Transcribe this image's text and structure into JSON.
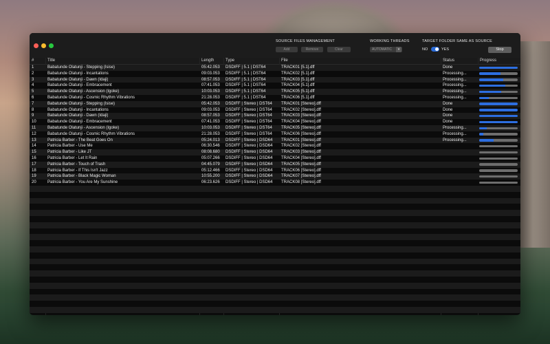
{
  "toolbar": {
    "source_group_label": "SOURCE FILES MANAGEMENT",
    "add_label": "Add",
    "remove_label": "Remove",
    "clear_label": "Clear",
    "threads_label": "WORKING THREADS",
    "threads_value": "AUTOMATIC",
    "target_label": "TARGET FOLDER SAME AS SOURCE",
    "toggle_no": "NO",
    "toggle_yes": "YES",
    "stop_label": "Stop"
  },
  "columns": {
    "num": "#",
    "title": "Title",
    "length": "Length",
    "type": "Type",
    "file": "File",
    "status": "Status",
    "progress": "Progress"
  },
  "rows": [
    {
      "num": "1",
      "title": "Babatunde Olatunji - Stepping (Isise)",
      "length": "05:42.053",
      "type": "DSDIFF | 5.1 | DST64",
      "file": "TRACK01 [5.1].dff",
      "status": "Done",
      "progress": 1.0
    },
    {
      "num": "2",
      "title": "Babatunde Olatunji - Incantations",
      "length": "09:03.053",
      "type": "DSDIFF | 5.1 | DST64",
      "file": "TRACK02 [5.1].dff",
      "status": "Processing...",
      "progress": 0.55
    },
    {
      "num": "3",
      "title": "Babatunde Olatunji - Dawn (Idaji)",
      "length": "08:57.053",
      "type": "DSDIFF | 5.1 | DST64",
      "file": "TRACK03 [5.1].dff",
      "status": "Processing...",
      "progress": 0.62
    },
    {
      "num": "4",
      "title": "Babatunde Olatunji - Embracement",
      "length": "07:41.053",
      "type": "DSDIFF | 5.1 | DST64",
      "file": "TRACK04 [5.1].dff",
      "status": "Processing...",
      "progress": 0.68
    },
    {
      "num": "5",
      "title": "Babatunde Olatunji - Ascension (Igoke)",
      "length": "10:03.053",
      "type": "DSDIFF | 5.1 | DST64",
      "file": "TRACK05 [5.1].dff",
      "status": "Processing...",
      "progress": 0.58
    },
    {
      "num": "6",
      "title": "Babatunde Olatunji - Cosmic Rhythm Vibrations",
      "length": "21:28.053",
      "type": "DSDIFF | 5.1 | DST64",
      "file": "TRACK06 [5.1].dff",
      "status": "Processing...",
      "progress": 0.25
    },
    {
      "num": "7",
      "title": "Babatunde Olatunji - Stepping (Isise)",
      "length": "05:42.053",
      "type": "DSDIFF | Stereo | DST64",
      "file": "TRACK01 [Stereo].dff",
      "status": "Done",
      "progress": 1.0
    },
    {
      "num": "8",
      "title": "Babatunde Olatunji - Incantations",
      "length": "09:03.053",
      "type": "DSDIFF | Stereo | DST64",
      "file": "TRACK02 [Stereo].dff",
      "status": "Done",
      "progress": 1.0
    },
    {
      "num": "9",
      "title": "Babatunde Olatunji - Dawn (Idaji)",
      "length": "08:57.053",
      "type": "DSDIFF | Stereo | DST64",
      "file": "TRACK03 [Stereo].dff",
      "status": "Done",
      "progress": 1.0
    },
    {
      "num": "10",
      "title": "Babatunde Olatunji - Embracement",
      "length": "07:41.053",
      "type": "DSDIFF | Stereo | DST64",
      "file": "TRACK04 [Stereo].dff",
      "status": "Done",
      "progress": 1.0
    },
    {
      "num": "11",
      "title": "Babatunde Olatunji - Ascension (Igoke)",
      "length": "10:03.053",
      "type": "DSDIFF | Stereo | DST64",
      "file": "TRACK05 [Stereo].dff",
      "status": "Processing...",
      "progress": 0.2
    },
    {
      "num": "12",
      "title": "Babatunde Olatunji - Cosmic Rhythm Vibrations",
      "length": "21:28.053",
      "type": "DSDIFF | Stereo | DST64",
      "file": "TRACK06 [Stereo].dff",
      "status": "Processing...",
      "progress": 0.1
    },
    {
      "num": "13",
      "title": "Patricia Barber - The Beat Goes On",
      "length": "05:24.013",
      "type": "DSDIFF | Stereo | DSD64",
      "file": "TRACK01 [Stereo].dff",
      "status": "Processing...",
      "progress": 0.38
    },
    {
      "num": "14",
      "title": "Patricia Barber - Use Me",
      "length": "06:30.546",
      "type": "DSDIFF | Stereo | DSD64",
      "file": "TRACK02 [Stereo].dff",
      "status": "",
      "progress": 0
    },
    {
      "num": "15",
      "title": "Patricia Barber - Like JT",
      "length": "08:08.680",
      "type": "DSDIFF | Stereo | DSD64",
      "file": "TRACK03 [Stereo].dff",
      "status": "",
      "progress": 0
    },
    {
      "num": "16",
      "title": "Patricia Barber - Let It Rain",
      "length": "05:07.266",
      "type": "DSDIFF | Stereo | DSD64",
      "file": "TRACK04 [Stereo].dff",
      "status": "",
      "progress": 0
    },
    {
      "num": "17",
      "title": "Patricia Barber - Touch of Trash",
      "length": "04:45.079",
      "type": "DSDIFF | Stereo | DSD64",
      "file": "TRACK05 [Stereo].dff",
      "status": "",
      "progress": 0
    },
    {
      "num": "18",
      "title": "Patricia Barber - If This Isn't Jazz",
      "length": "05:12.466",
      "type": "DSDIFF | Stereo | DSD64",
      "file": "TRACK06 [Stereo].dff",
      "status": "",
      "progress": 0
    },
    {
      "num": "19",
      "title": "Patricia Barber - Black Magic Woman",
      "length": "10:55.200",
      "type": "DSDIFF | Stereo | DSD64",
      "file": "TRACK07 [Stereo].dff",
      "status": "",
      "progress": 0
    },
    {
      "num": "20",
      "title": "Patricia Barber - You Are My Sunshine",
      "length": "06:23.626",
      "type": "DSDIFF | Stereo | DSD64",
      "file": "TRACK08 [Stereo].dff",
      "status": "",
      "progress": 0
    }
  ],
  "colors": {
    "progress_fill": "#2d6ee0",
    "progress_track": "#6e6e6e",
    "toggle_on": "#2a6ad6"
  }
}
